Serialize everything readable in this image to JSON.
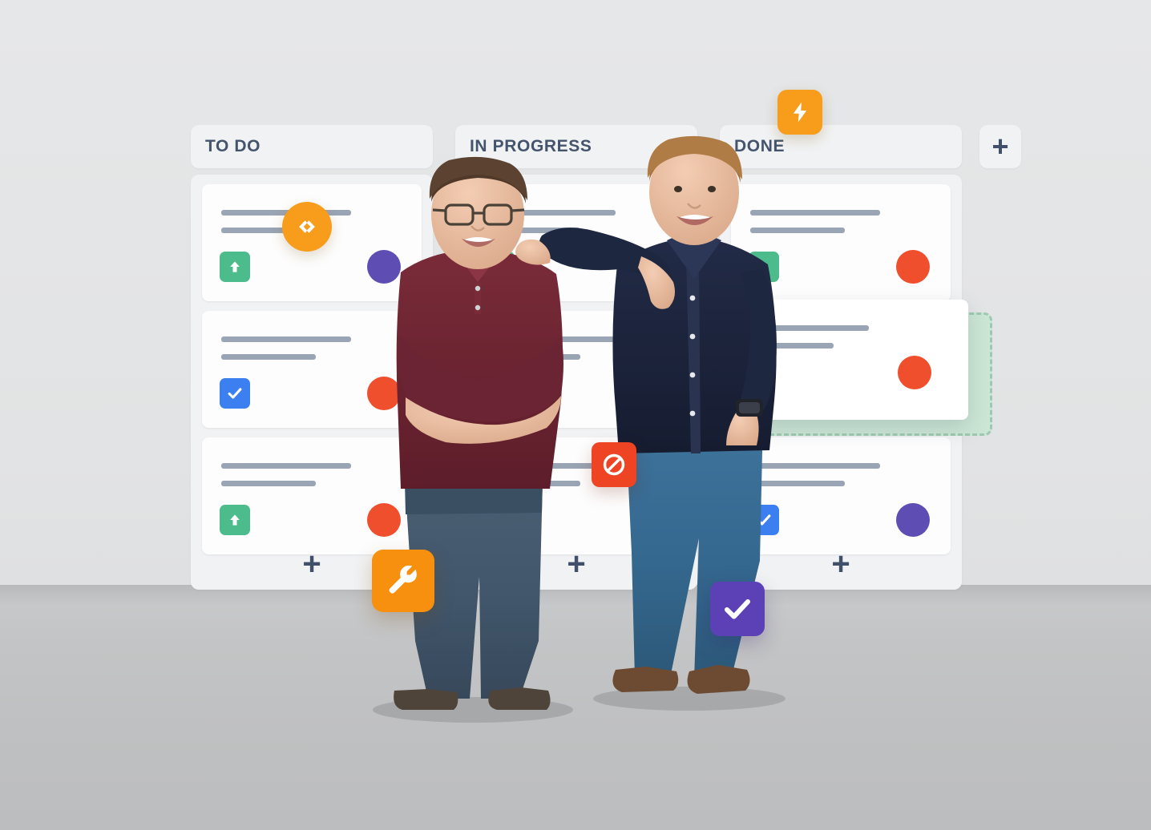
{
  "board": {
    "columns": [
      {
        "id": "todo",
        "title": "TO DO",
        "add_card_label": "+",
        "cards": [
          {
            "chip_icon": "arrow-up-icon",
            "chip_color": "#4cbc8d",
            "avatar_color": "#5e4db2"
          },
          {
            "chip_icon": "checkbox-icon",
            "chip_color": "#3b7ff0",
            "avatar_color": "#ef4f2c"
          },
          {
            "chip_icon": "arrow-up-icon",
            "chip_color": "#4cbc8d",
            "avatar_color": "#ef4f2c"
          }
        ]
      },
      {
        "id": "in-progress",
        "title": "IN PROGRESS",
        "add_card_label": "+",
        "cards": [
          {
            "chip_icon": "arrow-up-icon",
            "chip_color": "#4cbc8d",
            "avatar_color": "#ef4f2c"
          },
          {
            "chip_icon": "arrow-up-icon",
            "chip_color": "#4cbc8d",
            "avatar_color": "#ef4f2c"
          },
          {
            "chip_icon": "arrow-up-icon",
            "chip_color": "#4cbc8d",
            "avatar_color": "#ef4f2c"
          }
        ]
      },
      {
        "id": "done",
        "title": "DONE",
        "add_card_label": "+",
        "cards": [
          {
            "chip_icon": "arrow-up-icon",
            "chip_color": "#4cbc8d",
            "avatar_color": "#ef4f2c"
          },
          {
            "chip_icon": "checkbox-icon",
            "chip_color": "#3b7ff0",
            "avatar_color": "#ef4f2c"
          },
          {
            "chip_icon": "checkbox-icon",
            "chip_color": "#3b7ff0",
            "avatar_color": "#5e4db2"
          }
        ]
      }
    ],
    "add_column_label": "+",
    "drag": {
      "active": true,
      "column": "done",
      "dropzone_color": "#cbe6d5",
      "dropzone_border_color": "#9ec9b0",
      "card_avatar_color": "#ef4f2c"
    }
  },
  "badges": [
    {
      "id": "bolt",
      "icon": "lightning-bolt-icon",
      "color": "#f89c1c",
      "shape": "rounded-square"
    },
    {
      "id": "code",
      "icon": "code-brackets-icon",
      "color": "#f89c1c",
      "shape": "circle"
    },
    {
      "id": "block",
      "icon": "blocked-icon",
      "color": "#ef4423",
      "shape": "rounded-square"
    },
    {
      "id": "wrench",
      "icon": "wrench-icon",
      "color": "#f8900f",
      "shape": "rounded-square"
    },
    {
      "id": "check",
      "icon": "check-icon",
      "color": "#5b41b5",
      "shape": "rounded-square"
    }
  ],
  "theme": {
    "background": "#e3e4e5",
    "floor": "#c2c3c4",
    "column_surface": "#f1f2f3",
    "card_surface": "#fdfdfd",
    "title_text": "#44546c",
    "placeholder_line": "#99a4b4",
    "plus_glyph": "#40506a"
  },
  "people": {
    "left_person": {
      "shirt_color": "#6b2230",
      "jeans_color": "#41566b",
      "pose": "arms-crossed"
    },
    "right_person": {
      "shirt_color": "#1b2239",
      "jeans_color": "#35688f",
      "pose": "leaning-arm-on-shoulder"
    }
  }
}
